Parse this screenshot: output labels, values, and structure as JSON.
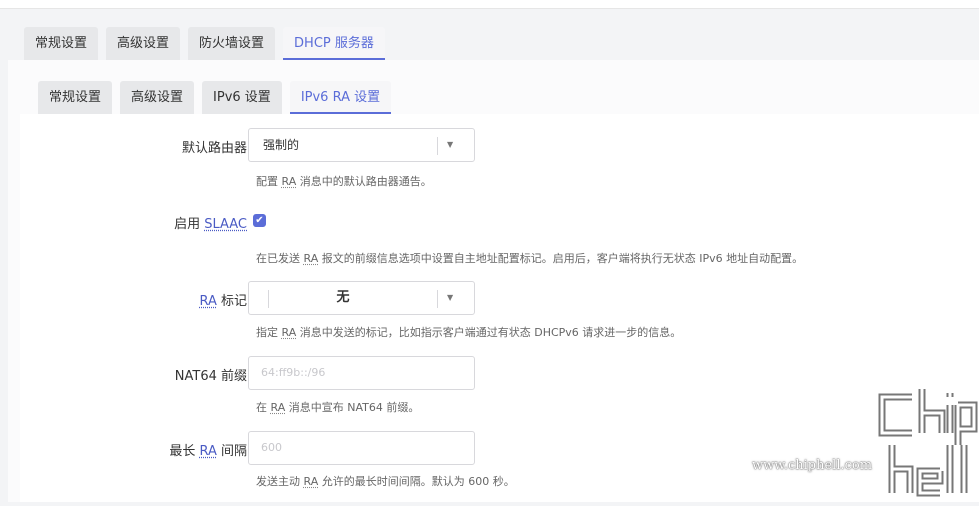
{
  "top_tabs": [
    {
      "label": "常规设置",
      "active": false
    },
    {
      "label": "高级设置",
      "active": false
    },
    {
      "label": "防火墙设置",
      "active": false
    },
    {
      "label": "DHCP 服务器",
      "active": true
    }
  ],
  "sub_tabs": [
    {
      "label": "常规设置",
      "active": false
    },
    {
      "label": "高级设置",
      "active": false
    },
    {
      "label": "IPv6 设置",
      "active": false
    },
    {
      "label": "IPv6 RA 设置",
      "active": true
    }
  ],
  "default_router": {
    "label": "默认路由器",
    "value": "强制的",
    "desc_pre": "配置 ",
    "desc_abbr": "RA",
    "desc_post": " 消息中的默认路由器通告。"
  },
  "slaac": {
    "label_pre": "启用 ",
    "label_abbr": "SLAAC",
    "checked": true,
    "desc_pre": "在已发送 ",
    "desc_abbr": "RA",
    "desc_post": " 报文的前缀信息选项中设置自主地址配置标记。启用后，客户端将执行无状态 IPv6 地址自动配置。"
  },
  "ra_flags": {
    "label_abbr": "RA",
    "label_post": " 标记",
    "value": "无",
    "desc_pre": "指定 ",
    "desc_abbr": "RA",
    "desc_post": " 消息中发送的标记，比如指示客户端通过有状态 DHCPv6 请求进一步的信息。"
  },
  "nat64": {
    "label": "NAT64 前缀",
    "placeholder": "64:ff9b::/96",
    "desc_pre": "在 ",
    "desc_abbr": "RA",
    "desc_post": " 消息中宣布 NAT64 前缀。"
  },
  "max_interval": {
    "label_pre": "最长 ",
    "label_abbr": "RA",
    "label_post": " 间隔",
    "placeholder": "600",
    "desc_pre": "发送主动 ",
    "desc_abbr": "RA",
    "desc_post": " 允许的最长时间间隔。默认为 600 秒。"
  },
  "watermark": {
    "url": "www.chiphell.com",
    "logo_text": "chip hell"
  },
  "colors": {
    "accent": "#5b6dd8",
    "tab_bg": "#e7e8ea",
    "page_bg": "#f3f4f6"
  }
}
